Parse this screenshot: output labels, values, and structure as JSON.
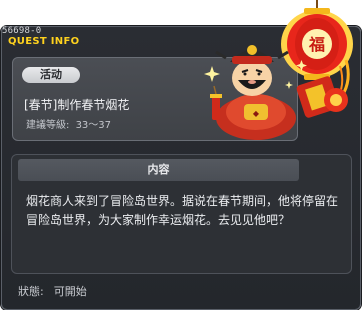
{
  "window": {
    "quest_id": "56698-0",
    "title": "QUEST INFO"
  },
  "quest": {
    "category": "活动",
    "name": "[春节]制作春节烟花",
    "level_label": "建議等級:",
    "level_range": "33～37"
  },
  "content": {
    "header": "内容",
    "body": "烟花商人来到了冒险岛世界。据说在春节期间，他将停留在冒险岛世界，为大家制作幸运烟花。去见见他吧？"
  },
  "status": {
    "label": "狀態:",
    "value": "可開始"
  },
  "npc": {
    "lantern_text": "福"
  },
  "colors": {
    "title_yellow": "#ffd21e",
    "panel_bg": "#2a2d33",
    "lantern_red": "#d8231a"
  }
}
